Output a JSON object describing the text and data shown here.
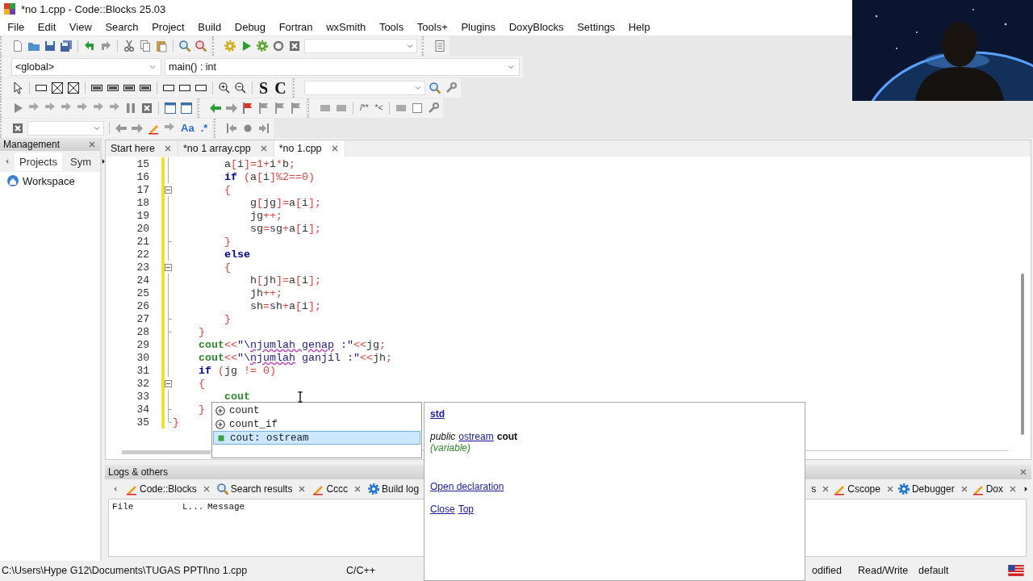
{
  "window": {
    "title": "*no 1.cpp - Code::Blocks 25.03"
  },
  "menu": [
    "File",
    "Edit",
    "View",
    "Search",
    "Project",
    "Build",
    "Debug",
    "Fortran",
    "wxSmith",
    "Tools",
    "Tools+",
    "Plugins",
    "DoxyBlocks",
    "Settings",
    "Help"
  ],
  "toolbar_texts": {
    "style_buttons": [
      "S",
      "C"
    ],
    "comment_buttons": [
      "/**",
      "*<"
    ],
    "search_options": [
      "Aa",
      ".*"
    ]
  },
  "scope": {
    "scope": "<global>",
    "function": "main() : int"
  },
  "management": {
    "title": "Management",
    "tabs": [
      {
        "label": "Projects",
        "selected": true
      },
      {
        "label": "Sym",
        "selected": false
      }
    ],
    "tree": [
      {
        "label": "Workspace"
      }
    ]
  },
  "editor": {
    "tabs": [
      {
        "label": "Start here",
        "selected": false
      },
      {
        "label": "*no 1 array.cpp",
        "selected": false
      },
      {
        "label": "*no 1.cpp",
        "selected": true
      }
    ],
    "lines": [
      {
        "number": "15",
        "modified": true,
        "fold_open": false,
        "fold_end": false,
        "code": [
          {
            "text": "        a",
            "kind": "plain"
          },
          {
            "text": "[",
            "kind": "operator"
          },
          {
            "text": "i",
            "kind": "plain"
          },
          {
            "text": "]=1+",
            "kind": "operator"
          },
          {
            "text": "i",
            "kind": "plain"
          },
          {
            "text": "*",
            "kind": "operator"
          },
          {
            "text": "b",
            "kind": "plain"
          },
          {
            "text": ";",
            "kind": "operator"
          }
        ]
      },
      {
        "number": "16",
        "modified": true,
        "fold_open": false,
        "fold_end": false,
        "code": [
          {
            "text": "        if",
            "kind": "keyword"
          },
          {
            "text": " (",
            "kind": "operator"
          },
          {
            "text": "a",
            "kind": "plain"
          },
          {
            "text": "[",
            "kind": "operator"
          },
          {
            "text": "i",
            "kind": "plain"
          },
          {
            "text": "]%2==0)",
            "kind": "operator"
          }
        ]
      },
      {
        "number": "17",
        "modified": true,
        "fold_open": true,
        "fold_end": false,
        "code": [
          {
            "text": "        {",
            "kind": "operator"
          }
        ]
      },
      {
        "number": "18",
        "modified": true,
        "fold_open": false,
        "fold_end": false,
        "code": [
          {
            "text": "            g",
            "kind": "plain"
          },
          {
            "text": "[",
            "kind": "operator"
          },
          {
            "text": "jg",
            "kind": "plain"
          },
          {
            "text": "]=",
            "kind": "operator"
          },
          {
            "text": "a",
            "kind": "plain"
          },
          {
            "text": "[",
            "kind": "operator"
          },
          {
            "text": "i",
            "kind": "plain"
          },
          {
            "text": "];",
            "kind": "operator"
          }
        ]
      },
      {
        "number": "19",
        "modified": true,
        "fold_open": false,
        "fold_end": false,
        "code": [
          {
            "text": "            jg",
            "kind": "plain"
          },
          {
            "text": "++;",
            "kind": "operator"
          }
        ]
      },
      {
        "number": "20",
        "modified": true,
        "fold_open": false,
        "fold_end": false,
        "code": [
          {
            "text": "            sg",
            "kind": "plain"
          },
          {
            "text": "=",
            "kind": "operator"
          },
          {
            "text": "sg",
            "kind": "plain"
          },
          {
            "text": "+",
            "kind": "operator"
          },
          {
            "text": "a",
            "kind": "plain"
          },
          {
            "text": "[",
            "kind": "operator"
          },
          {
            "text": "i",
            "kind": "plain"
          },
          {
            "text": "];",
            "kind": "operator"
          }
        ]
      },
      {
        "number": "21",
        "modified": true,
        "fold_open": false,
        "fold_end": true,
        "code": [
          {
            "text": "        }",
            "kind": "operator"
          }
        ]
      },
      {
        "number": "22",
        "modified": true,
        "fold_open": false,
        "fold_end": false,
        "code": [
          {
            "text": "        else",
            "kind": "keyword"
          }
        ]
      },
      {
        "number": "23",
        "modified": true,
        "fold_open": true,
        "fold_end": false,
        "code": [
          {
            "text": "        {",
            "kind": "operator"
          }
        ]
      },
      {
        "number": "24",
        "modified": true,
        "fold_open": false,
        "fold_end": false,
        "code": [
          {
            "text": "            h",
            "kind": "plain"
          },
          {
            "text": "[",
            "kind": "operator"
          },
          {
            "text": "jh",
            "kind": "plain"
          },
          {
            "text": "]=",
            "kind": "operator"
          },
          {
            "text": "a",
            "kind": "plain"
          },
          {
            "text": "[",
            "kind": "operator"
          },
          {
            "text": "i",
            "kind": "plain"
          },
          {
            "text": "];",
            "kind": "operator"
          }
        ]
      },
      {
        "number": "25",
        "modified": true,
        "fold_open": false,
        "fold_end": false,
        "code": [
          {
            "text": "            jh",
            "kind": "plain"
          },
          {
            "text": "++;",
            "kind": "operator"
          }
        ]
      },
      {
        "number": "26",
        "modified": true,
        "fold_open": false,
        "fold_end": false,
        "code": [
          {
            "text": "            sh",
            "kind": "plain"
          },
          {
            "text": "=",
            "kind": "operator"
          },
          {
            "text": "sh",
            "kind": "plain"
          },
          {
            "text": "+",
            "kind": "operator"
          },
          {
            "text": "a",
            "kind": "plain"
          },
          {
            "text": "[",
            "kind": "operator"
          },
          {
            "text": "i",
            "kind": "plain"
          },
          {
            "text": "];",
            "kind": "operator"
          }
        ]
      },
      {
        "number": "27",
        "modified": true,
        "fold_open": false,
        "fold_end": true,
        "code": [
          {
            "text": "        }",
            "kind": "operator"
          }
        ]
      },
      {
        "number": "28",
        "modified": true,
        "fold_open": false,
        "fold_end": true,
        "code": [
          {
            "text": "    }",
            "kind": "operator"
          }
        ]
      },
      {
        "number": "29",
        "modified": true,
        "fold_open": false,
        "fold_end": false,
        "code": [
          {
            "text": "    cout",
            "kind": "stream"
          },
          {
            "text": "<<",
            "kind": "operator"
          },
          {
            "text": "\"\\",
            "kind": "string"
          },
          {
            "text": "njumlah",
            "kind": "misspelled"
          },
          {
            "text": " genap",
            "kind": "misspelled"
          },
          {
            "text": " :\"",
            "kind": "string"
          },
          {
            "text": "<<",
            "kind": "operator"
          },
          {
            "text": "jg",
            "kind": "plain"
          },
          {
            "text": ";",
            "kind": "operator"
          }
        ]
      },
      {
        "number": "30",
        "modified": true,
        "fold_open": false,
        "fold_end": false,
        "code": [
          {
            "text": "    cout",
            "kind": "stream"
          },
          {
            "text": "<<",
            "kind": "operator"
          },
          {
            "text": "\"\\",
            "kind": "string"
          },
          {
            "text": "njumlah",
            "kind": "misspelled"
          },
          {
            "text": " ganjil :\"",
            "kind": "string"
          },
          {
            "text": "<<",
            "kind": "operator"
          },
          {
            "text": "jh",
            "kind": "plain"
          },
          {
            "text": ";",
            "kind": "operator"
          }
        ]
      },
      {
        "number": "31",
        "modified": true,
        "fold_open": false,
        "fold_end": false,
        "code": [
          {
            "text": "    if",
            "kind": "keyword"
          },
          {
            "text": " (",
            "kind": "operator"
          },
          {
            "text": "jg",
            "kind": "plain"
          },
          {
            "text": " != 0)",
            "kind": "operator"
          }
        ]
      },
      {
        "number": "32",
        "modified": true,
        "fold_open": true,
        "fold_end": false,
        "code": [
          {
            "text": "    {",
            "kind": "operator"
          }
        ]
      },
      {
        "number": "33",
        "modified": true,
        "fold_open": false,
        "fold_end": false,
        "code": [
          {
            "text": "        cout",
            "kind": "stream"
          }
        ]
      },
      {
        "number": "34",
        "modified": true,
        "fold_open": false,
        "fold_end": true,
        "code": [
          {
            "text": "    }",
            "kind": "operator"
          }
        ]
      },
      {
        "number": "35",
        "modified": true,
        "fold_open": false,
        "fold_end": true,
        "code": [
          {
            "text": "}",
            "kind": "operator"
          }
        ]
      }
    ]
  },
  "autocomplete": {
    "items": [
      {
        "kind": "function",
        "label": "count",
        "selected": false
      },
      {
        "kind": "function",
        "label": "count_if",
        "selected": false
      },
      {
        "kind": "variable",
        "label": "cout: ostream",
        "selected": true
      }
    ]
  },
  "doc_popup": {
    "namespace": "std",
    "modifier": "public",
    "type": "ostream",
    "name": "cout",
    "category": "(variable)",
    "links": [
      "Open declaration"
    ],
    "footer_links": [
      "Close",
      "Top"
    ]
  },
  "logs": {
    "title": "Logs & others",
    "tabs": [
      {
        "kind": "log",
        "label": "Code::Blocks"
      },
      {
        "kind": "search",
        "label": "Search results"
      },
      {
        "kind": "log",
        "label": "Cccc"
      },
      {
        "kind": "build",
        "label": "Build log"
      }
    ],
    "more_tabs": [
      {
        "kind": "none",
        "label": "s"
      },
      {
        "kind": "log",
        "label": "Cscope"
      },
      {
        "kind": "build",
        "label": "Debugger"
      },
      {
        "kind": "log",
        "label": "Dox"
      }
    ],
    "columns": [
      "File",
      "L...",
      "Message"
    ]
  },
  "status_bar": [
    "C:\\Users\\Hype G12\\Documents\\TUGAS PPTI\\no 1.cpp",
    "C/C++",
    "odified",
    "Read/Write",
    "default"
  ]
}
